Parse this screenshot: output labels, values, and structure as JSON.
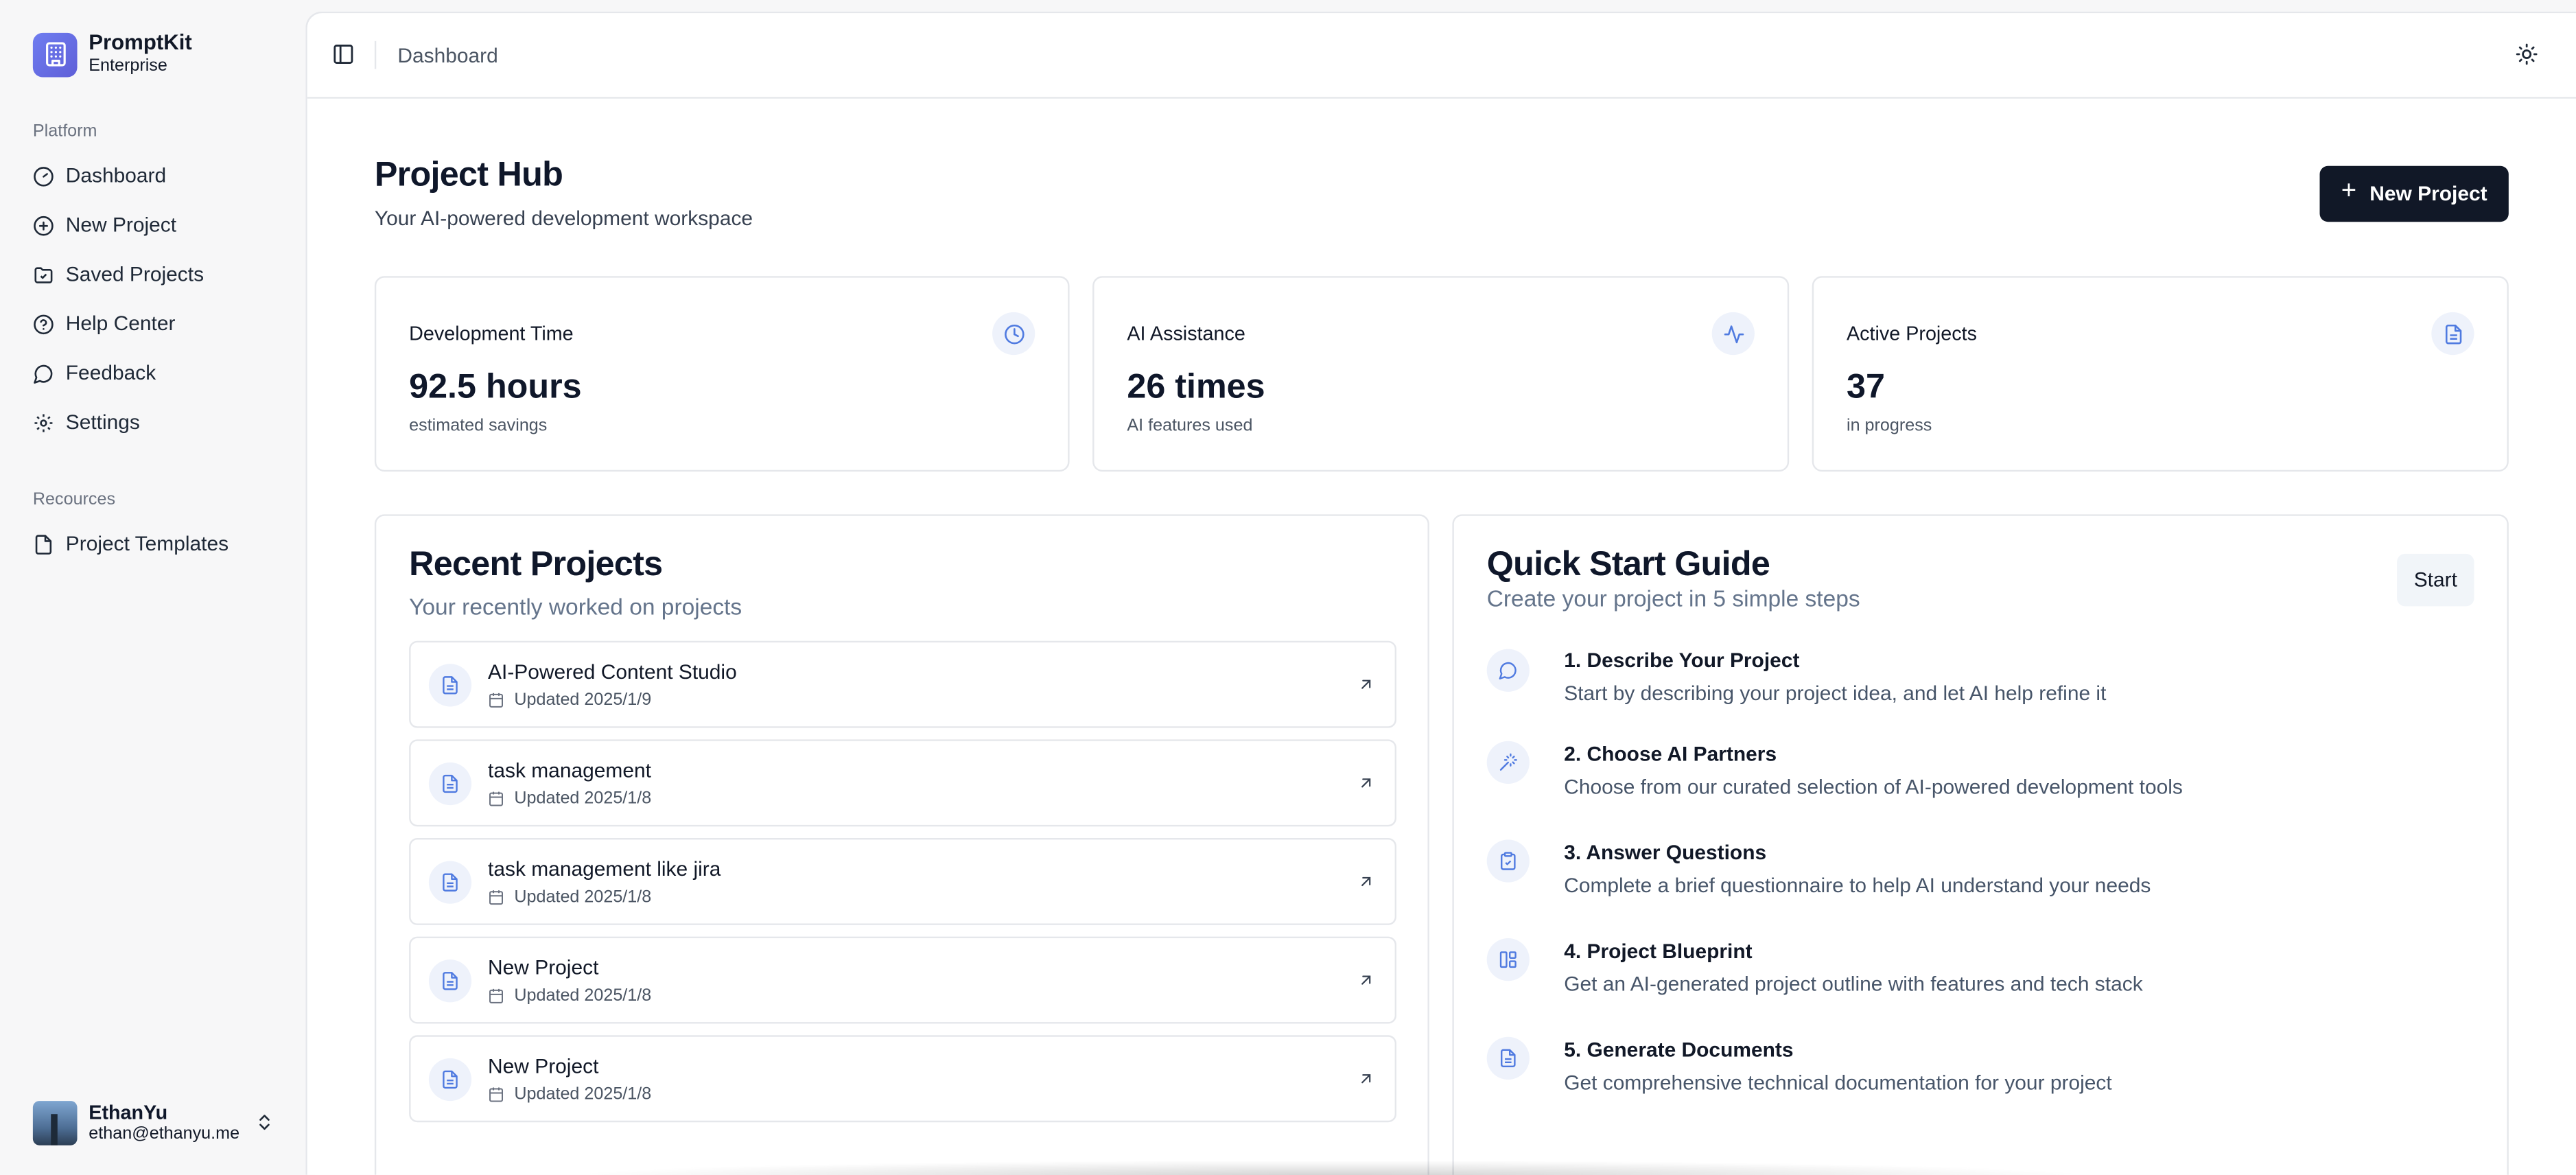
{
  "brand": {
    "name": "PromptKit",
    "subtitle": "Enterprise"
  },
  "sidebar": {
    "platform_label": "Platform",
    "items": [
      {
        "label": "Dashboard",
        "icon": "gauge-icon"
      },
      {
        "label": "New Project",
        "icon": "plus-circle-icon"
      },
      {
        "label": "Saved Projects",
        "icon": "folder-icon"
      },
      {
        "label": "Help Center",
        "icon": "help-circle-icon"
      },
      {
        "label": "Feedback",
        "icon": "message-icon"
      },
      {
        "label": "Settings",
        "icon": "gear-icon"
      }
    ],
    "resources_label": "Recources",
    "resources": [
      {
        "label": "Project Templates",
        "icon": "file-icon"
      }
    ]
  },
  "user": {
    "name": "EthanYu",
    "email": "ethan@ethanyu.me"
  },
  "topbar": {
    "breadcrumb": "Dashboard"
  },
  "header": {
    "title": "Project Hub",
    "subtitle": "Your AI-powered development workspace",
    "new_button": "New Project"
  },
  "stats": [
    {
      "title": "Development Time",
      "value": "92.5 hours",
      "note": "estimated savings",
      "icon": "clock-icon"
    },
    {
      "title": "AI Assistance",
      "value": "26 times",
      "note": "AI features used",
      "icon": "activity-icon"
    },
    {
      "title": "Active Projects",
      "value": "37",
      "note": "in progress",
      "icon": "document-icon"
    }
  ],
  "recent": {
    "title": "Recent Projects",
    "subtitle": "Your recently worked on projects",
    "items": [
      {
        "name": "AI-Powered Content Studio",
        "date": "Updated 2025/1/9"
      },
      {
        "name": "task management",
        "date": "Updated 2025/1/8"
      },
      {
        "name": "task management like jira",
        "date": "Updated 2025/1/8"
      },
      {
        "name": "New Project",
        "date": "Updated 2025/1/8"
      },
      {
        "name": "New Project",
        "date": "Updated 2025/1/8"
      }
    ]
  },
  "guide": {
    "title": "Quick Start Guide",
    "subtitle": "Create your project in 5 simple steps",
    "start_button": "Start",
    "steps": [
      {
        "title": "1. Describe Your Project",
        "desc": "Start by describing your project idea, and let AI help refine it",
        "icon": "chat-bubble-icon"
      },
      {
        "title": "2. Choose AI Partners",
        "desc": "Choose from our curated selection of AI-powered development tools",
        "icon": "magic-wand-icon"
      },
      {
        "title": "3. Answer Questions",
        "desc": "Complete a brief questionnaire to help AI understand your needs",
        "icon": "clipboard-check-icon"
      },
      {
        "title": "4. Project Blueprint",
        "desc": "Get an AI-generated project outline with features and tech stack",
        "icon": "layout-icon"
      },
      {
        "title": "5. Generate Documents",
        "desc": "Get comprehensive technical documentation for your project",
        "icon": "document-icon"
      }
    ]
  }
}
